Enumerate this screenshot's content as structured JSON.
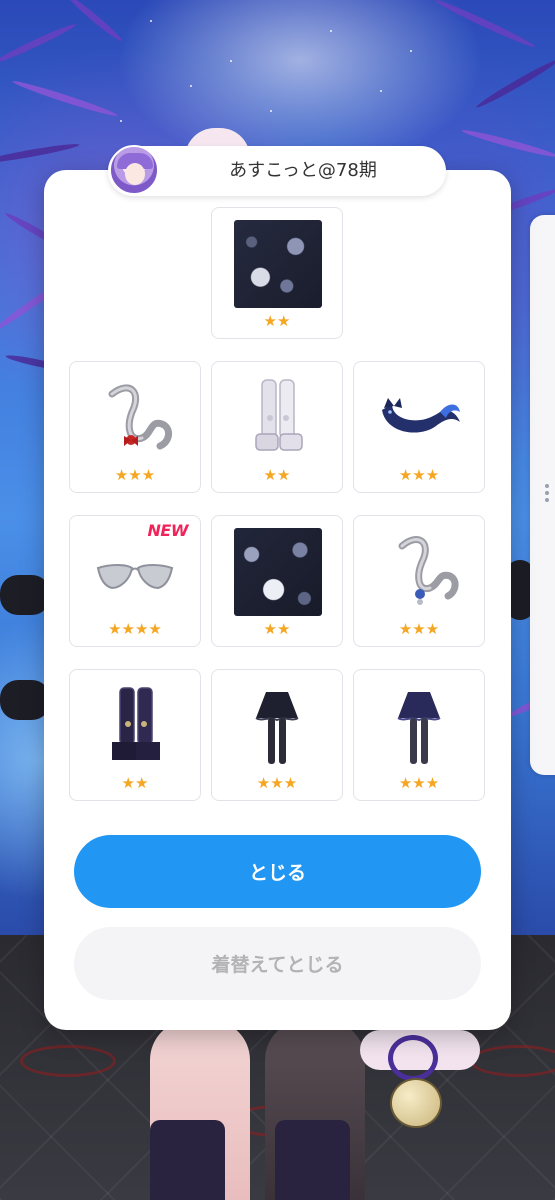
{
  "user": {
    "name": "あすこっと@78期"
  },
  "items": [
    {
      "name": "kimono-pattern-fabric",
      "rarity": "★★",
      "new": false
    },
    {
      "name": "cat-tail-with-red-tie",
      "rarity": "★★★",
      "new": false
    },
    {
      "name": "white-platform-boots",
      "rarity": "★★",
      "new": false
    },
    {
      "name": "navy-cat-fish-accessory",
      "rarity": "★★★",
      "new": false
    },
    {
      "name": "silver-cat-eye-glasses",
      "rarity": "★★★★",
      "new": true,
      "new_label": "NEW"
    },
    {
      "name": "dark-floral-pattern-fabric",
      "rarity": "★★",
      "new": false
    },
    {
      "name": "cat-tail-with-blue-bell",
      "rarity": "★★★",
      "new": false
    },
    {
      "name": "dark-purple-boots",
      "rarity": "★★",
      "new": false
    },
    {
      "name": "black-skirt-stockings",
      "rarity": "★★★",
      "new": false
    },
    {
      "name": "navy-skirt-stockings",
      "rarity": "★★★",
      "new": false
    }
  ],
  "buttons": {
    "close_label": "とじる",
    "change_close_label": "着替えてとじる"
  },
  "colors": {
    "primary": "#2196f3",
    "secondary_bg": "#f4f4f6",
    "secondary_text": "#b3b3b7",
    "star": "#f5a623",
    "new_badge": "#f0245a"
  }
}
